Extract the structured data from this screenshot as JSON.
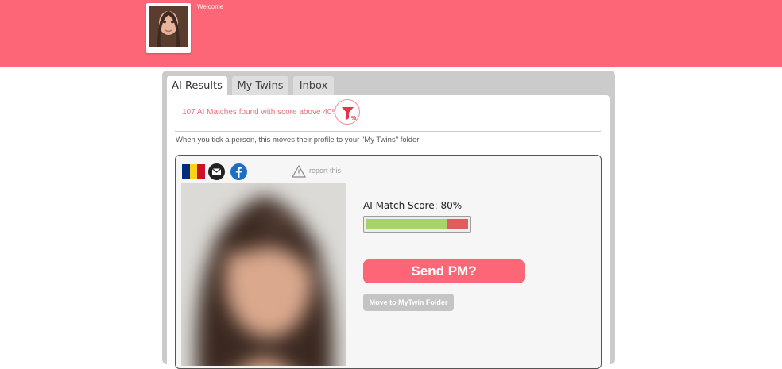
{
  "header": {
    "welcome_text": "Welcome",
    "avatar_icon": "user-avatar-photo",
    "background_color": "#fd6677"
  },
  "tabs": [
    {
      "label": "AI Results",
      "active": true
    },
    {
      "label": "My Twins",
      "active": false
    },
    {
      "label": "Inbox",
      "active": false
    }
  ],
  "results": {
    "matches_text": "107 AI Matches found with score above 40%",
    "filter_icon": "filter-percent-icon",
    "info_text": "When you tick a person, this moves their profile to your \"My Twins\" folder"
  },
  "profile_card": {
    "flag_colors": [
      "#002b7f",
      "#fcd116",
      "#ce1126"
    ],
    "report_label": "report this",
    "score_label": "AI Match Score: 80%",
    "score_value": 0.8,
    "send_pm_label": "Send PM?",
    "move_label": "Move to MyTwin Folder",
    "colors": {
      "score_fill": "#a6d46b",
      "score_remaining": "#e25c5e",
      "accent": "#fd6677"
    }
  }
}
